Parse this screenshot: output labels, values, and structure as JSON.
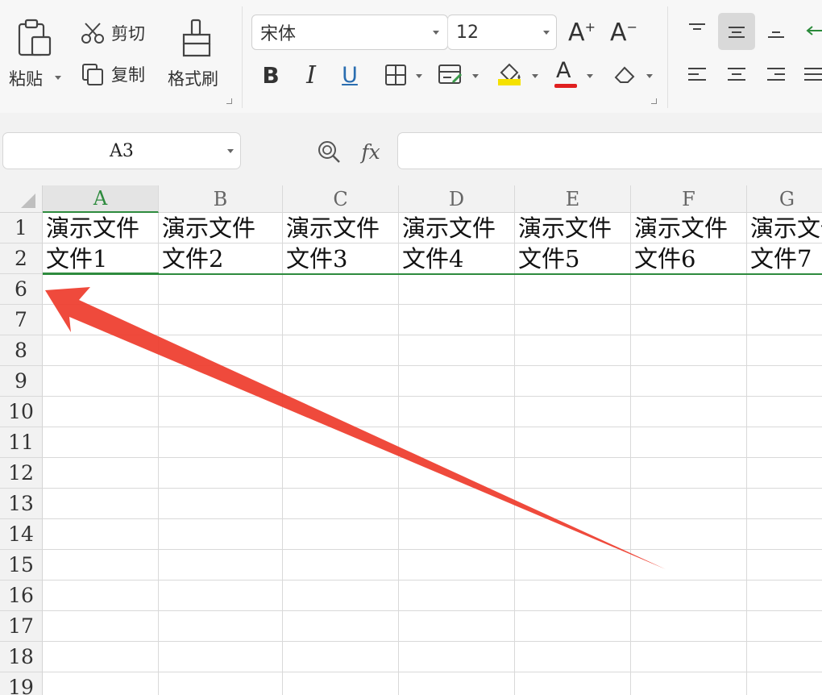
{
  "ribbon": {
    "paste_label": "粘贴",
    "cut_label": "剪切",
    "copy_label": "复制",
    "format_painter_label": "格式刷",
    "font_name": "宋体",
    "font_size": "12",
    "bold_glyph": "B",
    "italic_glyph": "I",
    "underline_glyph": "U",
    "font_color_hex": "#e02020",
    "fill_color_hex": "#f5e100"
  },
  "formula_bar": {
    "name_box": "A3",
    "fx_label": "fx",
    "formula": ""
  },
  "sheet": {
    "columns": [
      "A",
      "B",
      "C",
      "D",
      "E",
      "F",
      "G"
    ],
    "active_column": "A",
    "rows": [
      {
        "num": "1",
        "cells": [
          "演示文件",
          "演示文件",
          "演示文件",
          "演示文件",
          "演示文件",
          "演示文件",
          "演示文件"
        ]
      },
      {
        "num": "2",
        "cells": [
          "文件1",
          "文件2",
          "文件3",
          "文件4",
          "文件5",
          "文件6",
          "文件7"
        ]
      },
      {
        "num": "6",
        "cells": [
          "",
          "",
          "",
          "",
          "",
          "",
          ""
        ]
      },
      {
        "num": "7",
        "cells": [
          "",
          "",
          "",
          "",
          "",
          "",
          ""
        ]
      },
      {
        "num": "8",
        "cells": [
          "",
          "",
          "",
          "",
          "",
          "",
          ""
        ]
      },
      {
        "num": "9",
        "cells": [
          "",
          "",
          "",
          "",
          "",
          "",
          ""
        ]
      },
      {
        "num": "10",
        "cells": [
          "",
          "",
          "",
          "",
          "",
          "",
          ""
        ]
      },
      {
        "num": "11",
        "cells": [
          "",
          "",
          "",
          "",
          "",
          "",
          ""
        ]
      },
      {
        "num": "12",
        "cells": [
          "",
          "",
          "",
          "",
          "",
          "",
          ""
        ]
      },
      {
        "num": "13",
        "cells": [
          "",
          "",
          "",
          "",
          "",
          "",
          ""
        ]
      },
      {
        "num": "14",
        "cells": [
          "",
          "",
          "",
          "",
          "",
          "",
          ""
        ]
      },
      {
        "num": "15",
        "cells": [
          "",
          "",
          "",
          "",
          "",
          "",
          ""
        ]
      },
      {
        "num": "16",
        "cells": [
          "",
          "",
          "",
          "",
          "",
          "",
          ""
        ]
      },
      {
        "num": "17",
        "cells": [
          "",
          "",
          "",
          "",
          "",
          "",
          ""
        ]
      },
      {
        "num": "18",
        "cells": [
          "",
          "",
          "",
          "",
          "",
          "",
          ""
        ]
      },
      {
        "num": "19",
        "cells": [
          "",
          "",
          "",
          "",
          "",
          "",
          ""
        ]
      }
    ],
    "hidden_rows_marker_color": "#2e8b3e"
  },
  "annotation": {
    "arrow_color": "#ee3b2b"
  }
}
